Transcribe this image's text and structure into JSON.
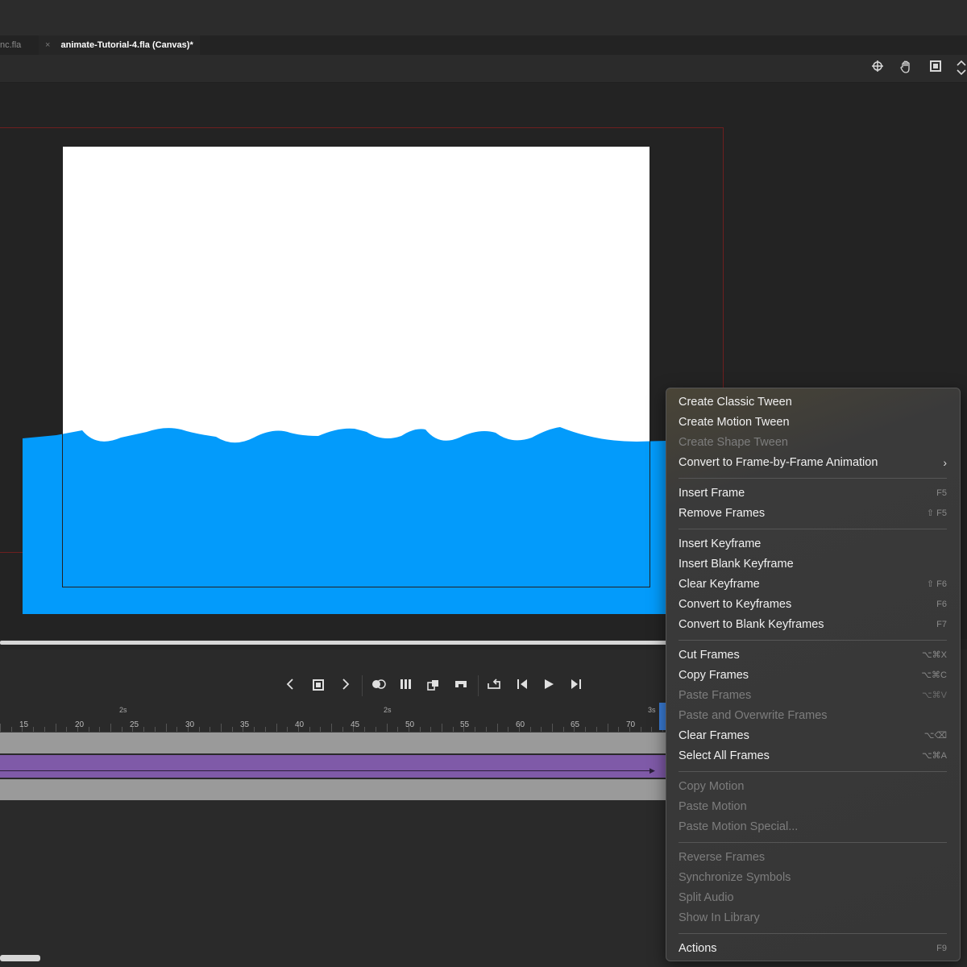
{
  "tabs": [
    {
      "label": "nc.fla"
    },
    {
      "label": "animate-Tutorial-4.fla (Canvas)*",
      "close": "×"
    }
  ],
  "toolbar_icons": [
    "crosshair-icon",
    "hand-icon",
    "frame-clip-icon",
    "expand-icon"
  ],
  "timeline": {
    "seconds": [
      "2s",
      "2s",
      "3s"
    ],
    "frames": [
      "15",
      "20",
      "25",
      "30",
      "35",
      "40",
      "45",
      "50",
      "55",
      "60",
      "65",
      "70"
    ],
    "controls": [
      "prev-keyframe-icon",
      "add-keyframe-icon",
      "next-keyframe-icon",
      "onion-skin-icon",
      "edit-multiple-frames-icon",
      "loop-icon",
      "step-back-icon",
      "play-icon",
      "step-forward-icon"
    ]
  },
  "colors": {
    "water": "#039bfb",
    "stage": "#ffffff",
    "layer_tween": "#7f5aa8",
    "layer_frames": "#9a9a9a",
    "playhead": "#3a7dd8"
  },
  "context_menu": {
    "groups": [
      [
        {
          "label": "Create Classic Tween",
          "shortcut": "",
          "enabled": true
        },
        {
          "label": "Create Motion Tween",
          "shortcut": "",
          "enabled": true
        },
        {
          "label": "Create Shape Tween",
          "shortcut": "",
          "enabled": false
        },
        {
          "label": "Convert to Frame-by-Frame Animation",
          "shortcut": "",
          "enabled": true,
          "submenu": "›"
        }
      ],
      [
        {
          "label": "Insert Frame",
          "shortcut": "F5",
          "enabled": true
        },
        {
          "label": "Remove Frames",
          "shortcut": "⇧ F5",
          "enabled": true
        }
      ],
      [
        {
          "label": "Insert Keyframe",
          "shortcut": "",
          "enabled": true
        },
        {
          "label": "Insert Blank Keyframe",
          "shortcut": "",
          "enabled": true
        },
        {
          "label": "Clear Keyframe",
          "shortcut": "⇧ F6",
          "enabled": true
        },
        {
          "label": "Convert to Keyframes",
          "shortcut": "F6",
          "enabled": true
        },
        {
          "label": "Convert to Blank Keyframes",
          "shortcut": "F7",
          "enabled": true
        }
      ],
      [
        {
          "label": "Cut Frames",
          "shortcut": "⌥⌘X",
          "enabled": true
        },
        {
          "label": "Copy Frames",
          "shortcut": "⌥⌘C",
          "enabled": true
        },
        {
          "label": "Paste Frames",
          "shortcut": "⌥⌘V",
          "enabled": false
        },
        {
          "label": "Paste and Overwrite Frames",
          "shortcut": "",
          "enabled": false
        },
        {
          "label": "Clear Frames",
          "shortcut": "⌥⌫",
          "enabled": true
        },
        {
          "label": "Select All Frames",
          "shortcut": "⌥⌘A",
          "enabled": true
        }
      ],
      [
        {
          "label": "Copy Motion",
          "shortcut": "",
          "enabled": false
        },
        {
          "label": "Paste Motion",
          "shortcut": "",
          "enabled": false
        },
        {
          "label": "Paste Motion Special...",
          "shortcut": "",
          "enabled": false
        }
      ],
      [
        {
          "label": "Reverse Frames",
          "shortcut": "",
          "enabled": false
        },
        {
          "label": "Synchronize Symbols",
          "shortcut": "",
          "enabled": false
        },
        {
          "label": "Split Audio",
          "shortcut": "",
          "enabled": false
        },
        {
          "label": "Show In Library",
          "shortcut": "",
          "enabled": false
        }
      ],
      [
        {
          "label": "Actions",
          "shortcut": "F9",
          "enabled": true
        }
      ]
    ]
  }
}
